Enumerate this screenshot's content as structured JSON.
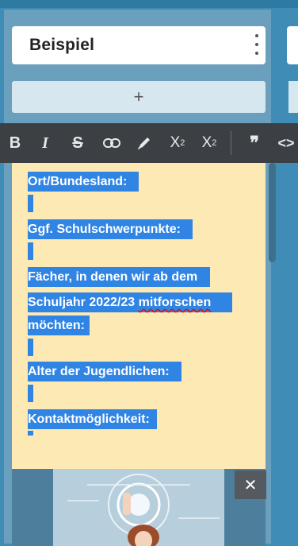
{
  "column": {
    "title": "Beispiel",
    "add_label": "+"
  },
  "toolbar": {
    "buttons": [
      {
        "name": "bold-button",
        "glyph": "B"
      },
      {
        "name": "italic-button",
        "glyph": "I"
      },
      {
        "name": "strikethrough-button",
        "glyph": "S"
      },
      {
        "name": "link-button",
        "glyph": "link"
      },
      {
        "name": "highlight-button",
        "glyph": "pen"
      },
      {
        "name": "superscript-button",
        "glyph": "X²"
      },
      {
        "name": "subscript-button",
        "glyph": "X₂"
      },
      {
        "name": "quote-button",
        "glyph": "❞"
      },
      {
        "name": "code-button",
        "glyph": "<>"
      }
    ]
  },
  "note": {
    "lines": [
      "Ort/Bundesland:",
      "Ggf. Schulschwerpunkte:",
      "Fächer, in denen wir ab dem",
      "Schuljahr 2022/23",
      "mitforschen",
      "möchten:",
      "Alter der Jugendlichen:",
      "Kontaktmöglichkeit:"
    ]
  },
  "image": {
    "close_label": "✕"
  },
  "colors": {
    "background": "#3f8db7",
    "toolbar": "#3c3f43",
    "note": "#fde9b3",
    "selection": "#2f84e4"
  }
}
